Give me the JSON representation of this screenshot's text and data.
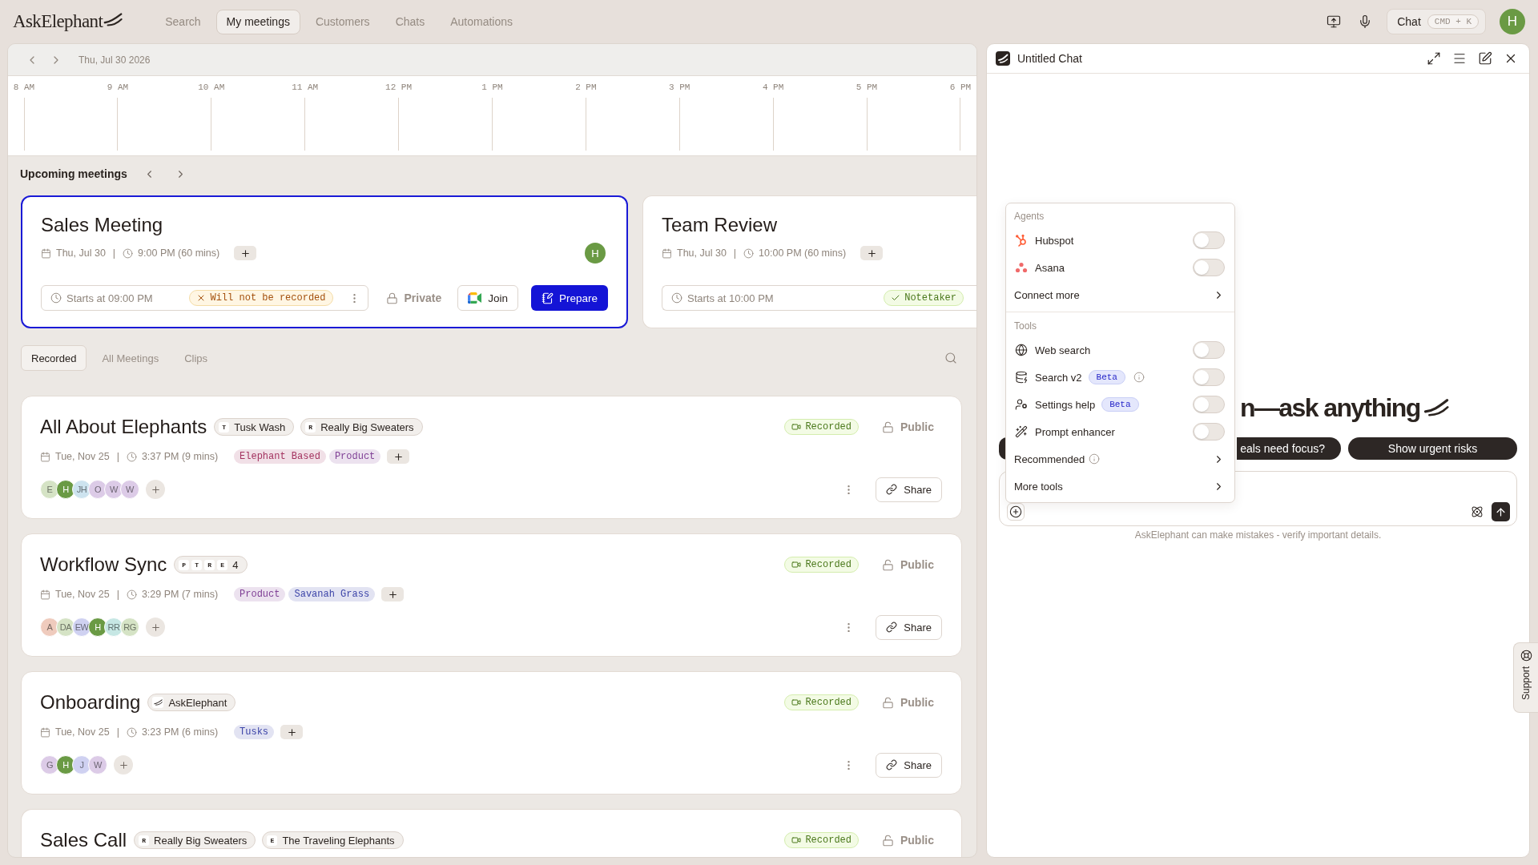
{
  "nav": {
    "logo": "AskElephant",
    "items": [
      {
        "label": "Search",
        "selected": false
      },
      {
        "label": "My meetings",
        "selected": true
      },
      {
        "label": "Customers",
        "selected": false
      },
      {
        "label": "Chats",
        "selected": false
      },
      {
        "label": "Automations",
        "selected": false
      }
    ],
    "chat_button": {
      "label": "Chat",
      "shortcut": "CMD + K"
    },
    "avatar": "H"
  },
  "calendar": {
    "date": "Thu, Jul 30 2026",
    "hours": [
      "8 AM",
      "9 AM",
      "10 AM",
      "11 AM",
      "12 PM",
      "1 PM",
      "2 PM",
      "3 PM",
      "4 PM",
      "5 PM",
      "6 PM"
    ]
  },
  "upcoming": {
    "title": "Upcoming meetings",
    "cards": [
      {
        "title": "Sales Meeting",
        "selected": true,
        "date": "Thu, Jul 30",
        "separator": "|",
        "time": "9:00 PM (60 mins)",
        "host": {
          "initials": "H",
          "color": "#6a9a44"
        },
        "starts": "Starts at 09:00 PM",
        "status": {
          "kind": "warning",
          "label": "Will not be recorded"
        },
        "visibility": {
          "label": "Private",
          "locked": true
        },
        "join": "Join",
        "prepare": "Prepare"
      },
      {
        "title": "Team Review",
        "selected": false,
        "date": "Thu, Jul 30",
        "separator": "|",
        "time": "10:00 PM (60 mins)",
        "starts": "Starts at 10:00 PM",
        "status": {
          "kind": "success",
          "label": "Notetaker"
        }
      }
    ]
  },
  "tabs": [
    {
      "label": "Recorded",
      "selected": true
    },
    {
      "label": "All Meetings",
      "selected": false
    },
    {
      "label": "Clips",
      "selected": false
    }
  ],
  "meetings": [
    {
      "title": "All About Elephants",
      "companies": [
        {
          "kind": "initials",
          "initials": [
            "T"
          ],
          "label": "Tusk Wash"
        },
        {
          "kind": "initials",
          "initials": [
            "R"
          ],
          "label": "Really Big Sweaters"
        }
      ],
      "status": {
        "kind": "recorded",
        "label": "Recorded"
      },
      "visibility": {
        "label": "Public",
        "locked": false
      },
      "date": "Tue, Nov 25",
      "separator": "|",
      "time": "3:37 PM (9 mins)",
      "tags": [
        {
          "label": "Elephant Based",
          "color": "#a3325f"
        },
        {
          "label": "Product",
          "color": "#7f3f95"
        }
      ],
      "attendees": [
        {
          "initials": "E",
          "color": "#d5e3c5"
        },
        {
          "initials": "H",
          "color": "#6a9a44"
        },
        {
          "initials": "JH",
          "color": "#cde3ef"
        },
        {
          "initials": "O",
          "color": "#dccbe7"
        },
        {
          "initials": "W",
          "color": "#dccbe7"
        },
        {
          "initials": "W",
          "color": "#dccbe7"
        }
      ],
      "share": "Share"
    },
    {
      "title": "Workflow Sync",
      "companies": [
        {
          "kind": "initials",
          "initials": [
            "P",
            "T",
            "R",
            "E"
          ],
          "label": "4"
        }
      ],
      "status": {
        "kind": "recorded",
        "label": "Recorded"
      },
      "visibility": {
        "label": "Public",
        "locked": false
      },
      "date": "Tue, Nov 25",
      "separator": "|",
      "time": "3:29 PM (7 mins)",
      "tags": [
        {
          "label": "Product",
          "color": "#7f3f95"
        },
        {
          "label": "Savanah Grass",
          "color": "#3c44a8"
        }
      ],
      "attendees": [
        {
          "initials": "A",
          "color": "#efcbbd"
        },
        {
          "initials": "DA",
          "color": "#d5e3c5"
        },
        {
          "initials": "EW",
          "color": "#cfd1f1"
        },
        {
          "initials": "H",
          "color": "#6a9a44"
        },
        {
          "initials": "RR",
          "color": "#c6e7e4"
        },
        {
          "initials": "RG",
          "color": "#d5e3c5"
        }
      ],
      "share": "Share"
    },
    {
      "title": "Onboarding",
      "companies": [
        {
          "kind": "logo",
          "label": "AskElephant"
        }
      ],
      "status": {
        "kind": "recorded",
        "label": "Recorded"
      },
      "visibility": {
        "label": "Public",
        "locked": false
      },
      "date": "Tue, Nov 25",
      "separator": "|",
      "time": "3:23 PM (6 mins)",
      "tags": [
        {
          "label": "Tusks",
          "color": "#3c44a8"
        }
      ],
      "attendees": [
        {
          "initials": "G",
          "color": "#dccbe7"
        },
        {
          "initials": "H",
          "color": "#6a9a44"
        },
        {
          "initials": "J",
          "color": "#cfd1f1"
        },
        {
          "initials": "W",
          "color": "#dccbe7"
        }
      ],
      "share": "Share"
    },
    {
      "title": "Sales Call",
      "companies": [
        {
          "kind": "initials",
          "initials": [
            "R"
          ],
          "label": "Really Big Sweaters"
        },
        {
          "kind": "initials",
          "initials": [
            "E"
          ],
          "label": "The Traveling Elephants"
        }
      ],
      "status": {
        "kind": "recorded",
        "label": "Recorded"
      },
      "visibility": {
        "label": "Public",
        "locked": false
      }
    }
  ],
  "chat": {
    "title": "Untitled Chat",
    "heading": "n—ask anything",
    "suggestions": [
      {
        "kind": "covered"
      },
      {
        "kind": "partial",
        "label": "eals need focus?"
      },
      {
        "kind": "full",
        "label": "Show urgent risks"
      }
    ],
    "disclaimer": "AskElephant can make mistakes - verify important details.",
    "menu": {
      "sections": [
        {
          "title": "Agents",
          "items": [
            {
              "kind": "toggle",
              "label": "Hubspot",
              "info": false,
              "on": false
            },
            {
              "kind": "toggle",
              "label": "Asana",
              "info": false,
              "on": false
            },
            {
              "kind": "submenu",
              "label": "Connect more",
              "info": false
            }
          ]
        },
        {
          "title": "Tools",
          "items": [
            {
              "kind": "toggle",
              "label": "Web search",
              "info": false,
              "on": false
            },
            {
              "kind": "toggle",
              "label": "Search v2",
              "badge": "Beta",
              "info": true,
              "on": false
            },
            {
              "kind": "toggle",
              "label": "Settings help",
              "badge": "Beta",
              "info": false,
              "on": false
            },
            {
              "kind": "toggle",
              "label": "Prompt enhancer",
              "info": false,
              "on": false
            },
            {
              "kind": "submenu",
              "label": "Recommended",
              "info": true
            },
            {
              "kind": "submenu",
              "label": "More tools",
              "info": false
            }
          ]
        }
      ]
    },
    "support": "Support"
  }
}
